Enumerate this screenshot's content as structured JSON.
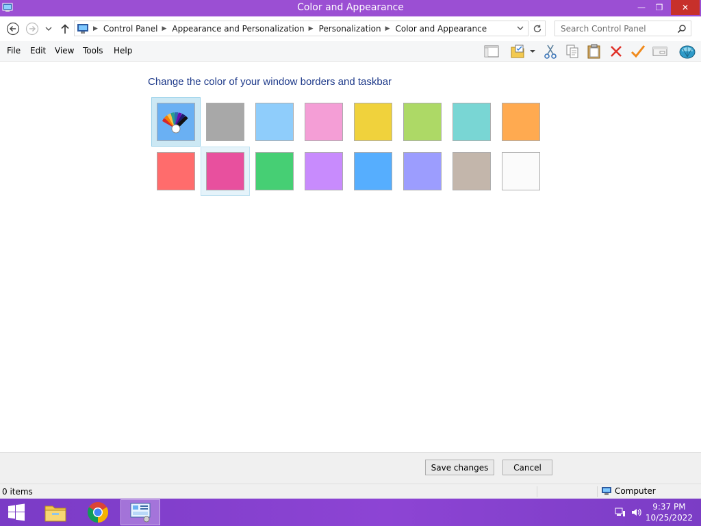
{
  "window": {
    "title": "Color and Appearance",
    "minimize_glyph": "—",
    "maximize_glyph": "❐",
    "close_glyph": "✕"
  },
  "address": {
    "breadcrumbs": [
      "Control Panel",
      "Appearance and Personalization",
      "Personalization",
      "Color and Appearance"
    ],
    "search_placeholder": "Search Control Panel"
  },
  "menu": [
    "File",
    "Edit",
    "View",
    "Tools",
    "Help"
  ],
  "toolbar_icons": [
    "layout-icon",
    "folder-options-icon",
    "dropdown-arrow-icon",
    "cut-icon",
    "copy-icon",
    "paste-icon",
    "delete-icon",
    "check-icon",
    "properties-icon",
    "shell-icon"
  ],
  "main": {
    "heading": "Change the color of your window borders and taskbar",
    "colors": [
      {
        "name": "automatic",
        "hex": "#6ab0f3",
        "selected": true
      },
      {
        "name": "gray",
        "hex": "#a8a8a8"
      },
      {
        "name": "sky-blue",
        "hex": "#8fcdfb"
      },
      {
        "name": "pink",
        "hex": "#f49ed6"
      },
      {
        "name": "yellow",
        "hex": "#f0d23c"
      },
      {
        "name": "lime",
        "hex": "#add966"
      },
      {
        "name": "teal",
        "hex": "#79d6d4"
      },
      {
        "name": "orange",
        "hex": "#ffaa50"
      },
      {
        "name": "red",
        "hex": "#ff6c6c"
      },
      {
        "name": "magenta",
        "hex": "#e8509e",
        "hover": true
      },
      {
        "name": "green",
        "hex": "#46cf74"
      },
      {
        "name": "violet",
        "hex": "#c88bfd"
      },
      {
        "name": "blue",
        "hex": "#56aefe"
      },
      {
        "name": "periwinkle",
        "hex": "#9c9dfe"
      },
      {
        "name": "taupe",
        "hex": "#c3b6ab"
      },
      {
        "name": "white",
        "hex": "#fbfbfb"
      }
    ]
  },
  "buttons": {
    "save": "Save changes",
    "cancel": "Cancel"
  },
  "status": {
    "items": "0 items",
    "location": "Computer"
  },
  "taskbar": {
    "apps": [
      "start-icon",
      "file-explorer-icon",
      "chrome-icon",
      "control-panel-icon"
    ],
    "time": "9:37 PM",
    "date": "10/25/2022"
  },
  "colors": {
    "titlebar": "#9b4fd3",
    "close": "#c7302b",
    "heading": "#1e3a8a",
    "taskbar": "#8d44d4"
  }
}
